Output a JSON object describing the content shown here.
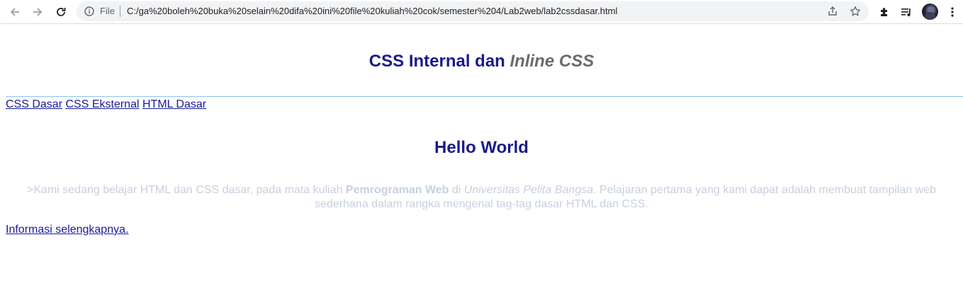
{
  "browser": {
    "file_label": "File",
    "url": "C:/ga%20boleh%20buka%20selain%20difa%20ini%20file%20kuliah%20cok/semester%204/Lab2web/lab2cssdasar.html",
    "icons": [
      "back-arrow-icon",
      "forward-arrow-icon",
      "reload-icon",
      "info-icon",
      "share-icon",
      "star-icon",
      "puzzle-icon",
      "media-queue-icon",
      "profile-avatar",
      "kebab-menu-icon"
    ]
  },
  "page": {
    "title_main": "CSS Internal dan",
    "title_inline": "Inline CSS",
    "nav": [
      {
        "label": "CSS Dasar"
      },
      {
        "label": "CSS Eksternal"
      },
      {
        "label": "HTML Dasar"
      }
    ],
    "hello": "Hello World",
    "paragraph": {
      "part1": ">Kami sedang belajar HTML dan CSS dasar, pada mata kuliah ",
      "bold": "Pemrograman Web",
      "part2": " di ",
      "italic": "Universitas Pelita Bangsa",
      "part3": ". Pelajaran pertama yang kami dapat adalah membuat tampilan web sederhana dalam rangka mengenal tag-tag dasar HTML dan CSS."
    },
    "more_link": "Informasi selengkapnya."
  },
  "colors": {
    "heading": "#1a1a8c",
    "heading_inline": "#6b6b6b",
    "link": "#1a1a9a",
    "paragraph": "#c7d0df",
    "rule": "#8ec3e6"
  }
}
